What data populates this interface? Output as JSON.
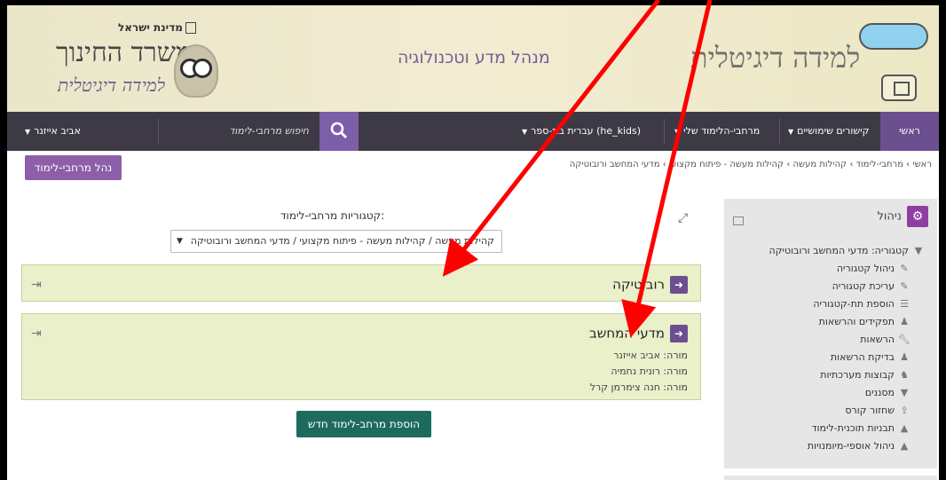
{
  "header": {
    "state_label": "מדינת ישראל",
    "ministry_title": "משרד החינוך",
    "ministry_sub": "למידה דיגיטלית",
    "department": "מנהל מדע וטכנולוגיה",
    "site_title": "למידה דיגיטלית"
  },
  "nav": {
    "home": "ראשי",
    "links": "קישורים שימושיים",
    "spaces": "מרחבי-הלימוד שלי",
    "lang": "עברית בת-ספר (he_kids)",
    "search_placeholder": "חיפוש מרחבי-לימוד",
    "user": "אביב אייזנר"
  },
  "manage_button": "נהל מרחבי-לימוד",
  "breadcrumb": "ראשי › מרחבי-לימוד › קהילות מעשה › קהילות מעשה - פיתוח מקצועי › מדעי המחשב ורובוטיקה",
  "categories": {
    "label": "קטגוריות מרחבי-לימוד:",
    "selected": "קהילות מעשה / קהילות מעשה - פיתוח מקצועי / מדעי המחשב ורובוטיקה"
  },
  "panels": [
    {
      "title": "רובוטיקה",
      "teachers": []
    },
    {
      "title": "מדעי המחשב",
      "teachers": [
        "מורה: אביב אייזנר",
        "מורה: רונית נחמיה",
        "מורה: חנה צימרמן קרל"
      ]
    }
  ],
  "add_button": "הוספת מרחב-לימוד חדש",
  "sidebar": {
    "title": "ניהול",
    "category": "קטגוריה: מדעי המחשב ורובוטיקה",
    "items": [
      "ניהול קטגוריה",
      "עריכת קטגוריה",
      "הוספת תת-קטגוריה",
      "תפקידים והרשאות",
      "הרשאות",
      "בדיקת הרשאות",
      "קבוצות מערכתיות",
      "מסננים",
      "שחזור קורס",
      "תבניות תוכנית-לימוד",
      "ניהול אוספי-מיומנויות"
    ]
  },
  "colors": {
    "nav_bg": "#3d3a45",
    "accent_purple": "#6b4f8f",
    "panel_bg": "#eaf0c9",
    "add_button_bg": "#1d6b5e",
    "arrow_red": "#ff0000"
  }
}
